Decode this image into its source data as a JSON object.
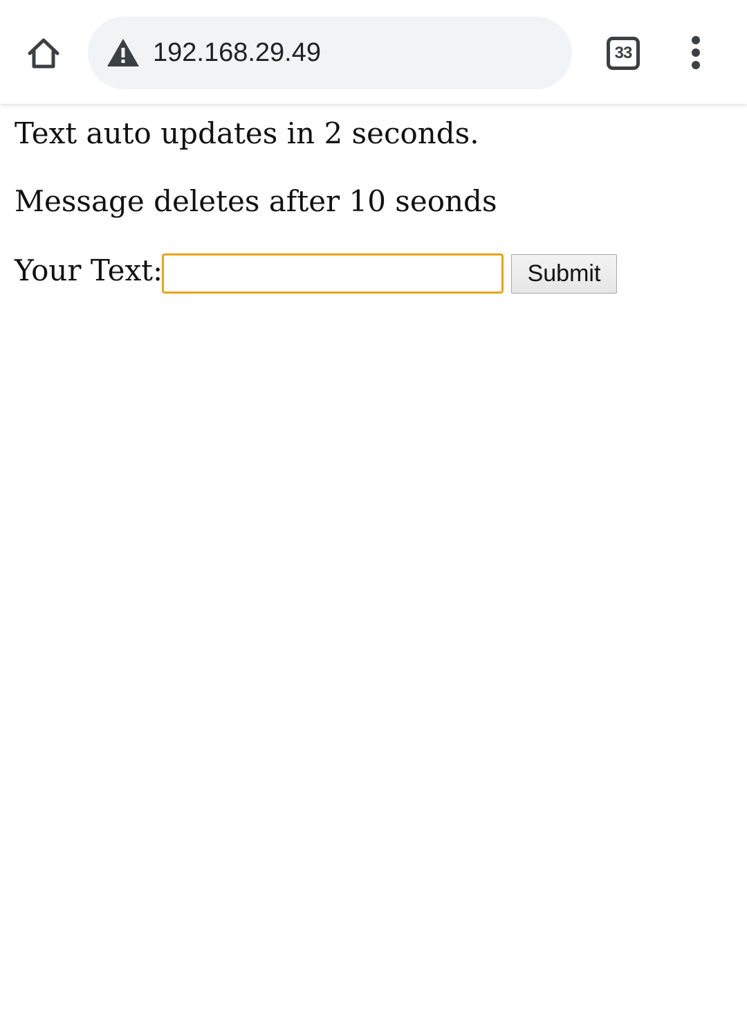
{
  "browser": {
    "url": "192.168.29.49",
    "tab_count": "33",
    "security_icon": "warning-triangle-icon",
    "home_icon": "home-icon",
    "menu_icon": "more-vertical-icon"
  },
  "page": {
    "line1": "Text auto updates in 2 seconds.",
    "line2": "Message deletes after 10 seonds",
    "form": {
      "label": "Your Text:",
      "input_value": "",
      "submit_label": "Submit"
    }
  },
  "colors": {
    "input_border": "#e8a317",
    "omnibox_bg": "#f1f3f4",
    "icon": "#3c4043"
  }
}
